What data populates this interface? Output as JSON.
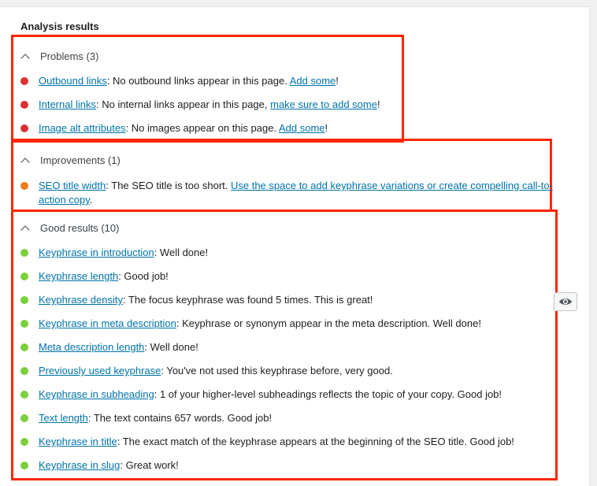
{
  "panel": {
    "title": "Analysis results"
  },
  "colors": {
    "problem": "#dc3232",
    "improvement": "#ee7c1b",
    "good": "#7ad03a",
    "link": "#0073aa",
    "highlight": "#ff2600"
  },
  "sections": {
    "problems": {
      "label": "Problems (3)",
      "items": [
        {
          "link": "Outbound links",
          "text": ": No outbound links appear in this page. ",
          "action": "Add some",
          "end": "!"
        },
        {
          "link": "Internal links",
          "text": ": No internal links appear in this page, ",
          "action": "make sure to add some",
          "end": "!"
        },
        {
          "link": "Image alt attributes",
          "text": ": No images appear on this page. ",
          "action": "Add some",
          "end": "!"
        }
      ]
    },
    "improvements": {
      "label": "Improvements (1)",
      "items": [
        {
          "link": "SEO title width",
          "text": ": The SEO title is too short. ",
          "action": "Use the space to add keyphrase variations or create compelling call-to-action copy",
          "end": "."
        }
      ]
    },
    "good": {
      "label": "Good results (10)",
      "items": [
        {
          "link": "Keyphrase in introduction",
          "text": ": Well done!"
        },
        {
          "link": "Keyphrase length",
          "text": ": Good job!"
        },
        {
          "link": "Keyphrase density",
          "text": ": The focus keyphrase was found 5 times. This is great!"
        },
        {
          "link": "Keyphrase in meta description",
          "text": ": Keyphrase or synonym appear in the meta description. Well done!"
        },
        {
          "link": "Meta description length",
          "text": ": Well done!"
        },
        {
          "link": "Previously used keyphrase",
          "text": ": You've not used this keyphrase before, very good."
        },
        {
          "link": "Keyphrase in subheading",
          "text": ": 1 of your higher-level subheadings reflects the topic of your copy. Good job!"
        },
        {
          "link": "Text length",
          "text": ": The text contains 657 words. Good job!"
        },
        {
          "link": "Keyphrase in title",
          "text": ": The exact match of the keyphrase appears at the beginning of the SEO title. Good job!"
        },
        {
          "link": "Keyphrase in slug",
          "text": ": Great work!"
        }
      ]
    }
  },
  "side_button": {
    "icon": "eye-icon"
  }
}
